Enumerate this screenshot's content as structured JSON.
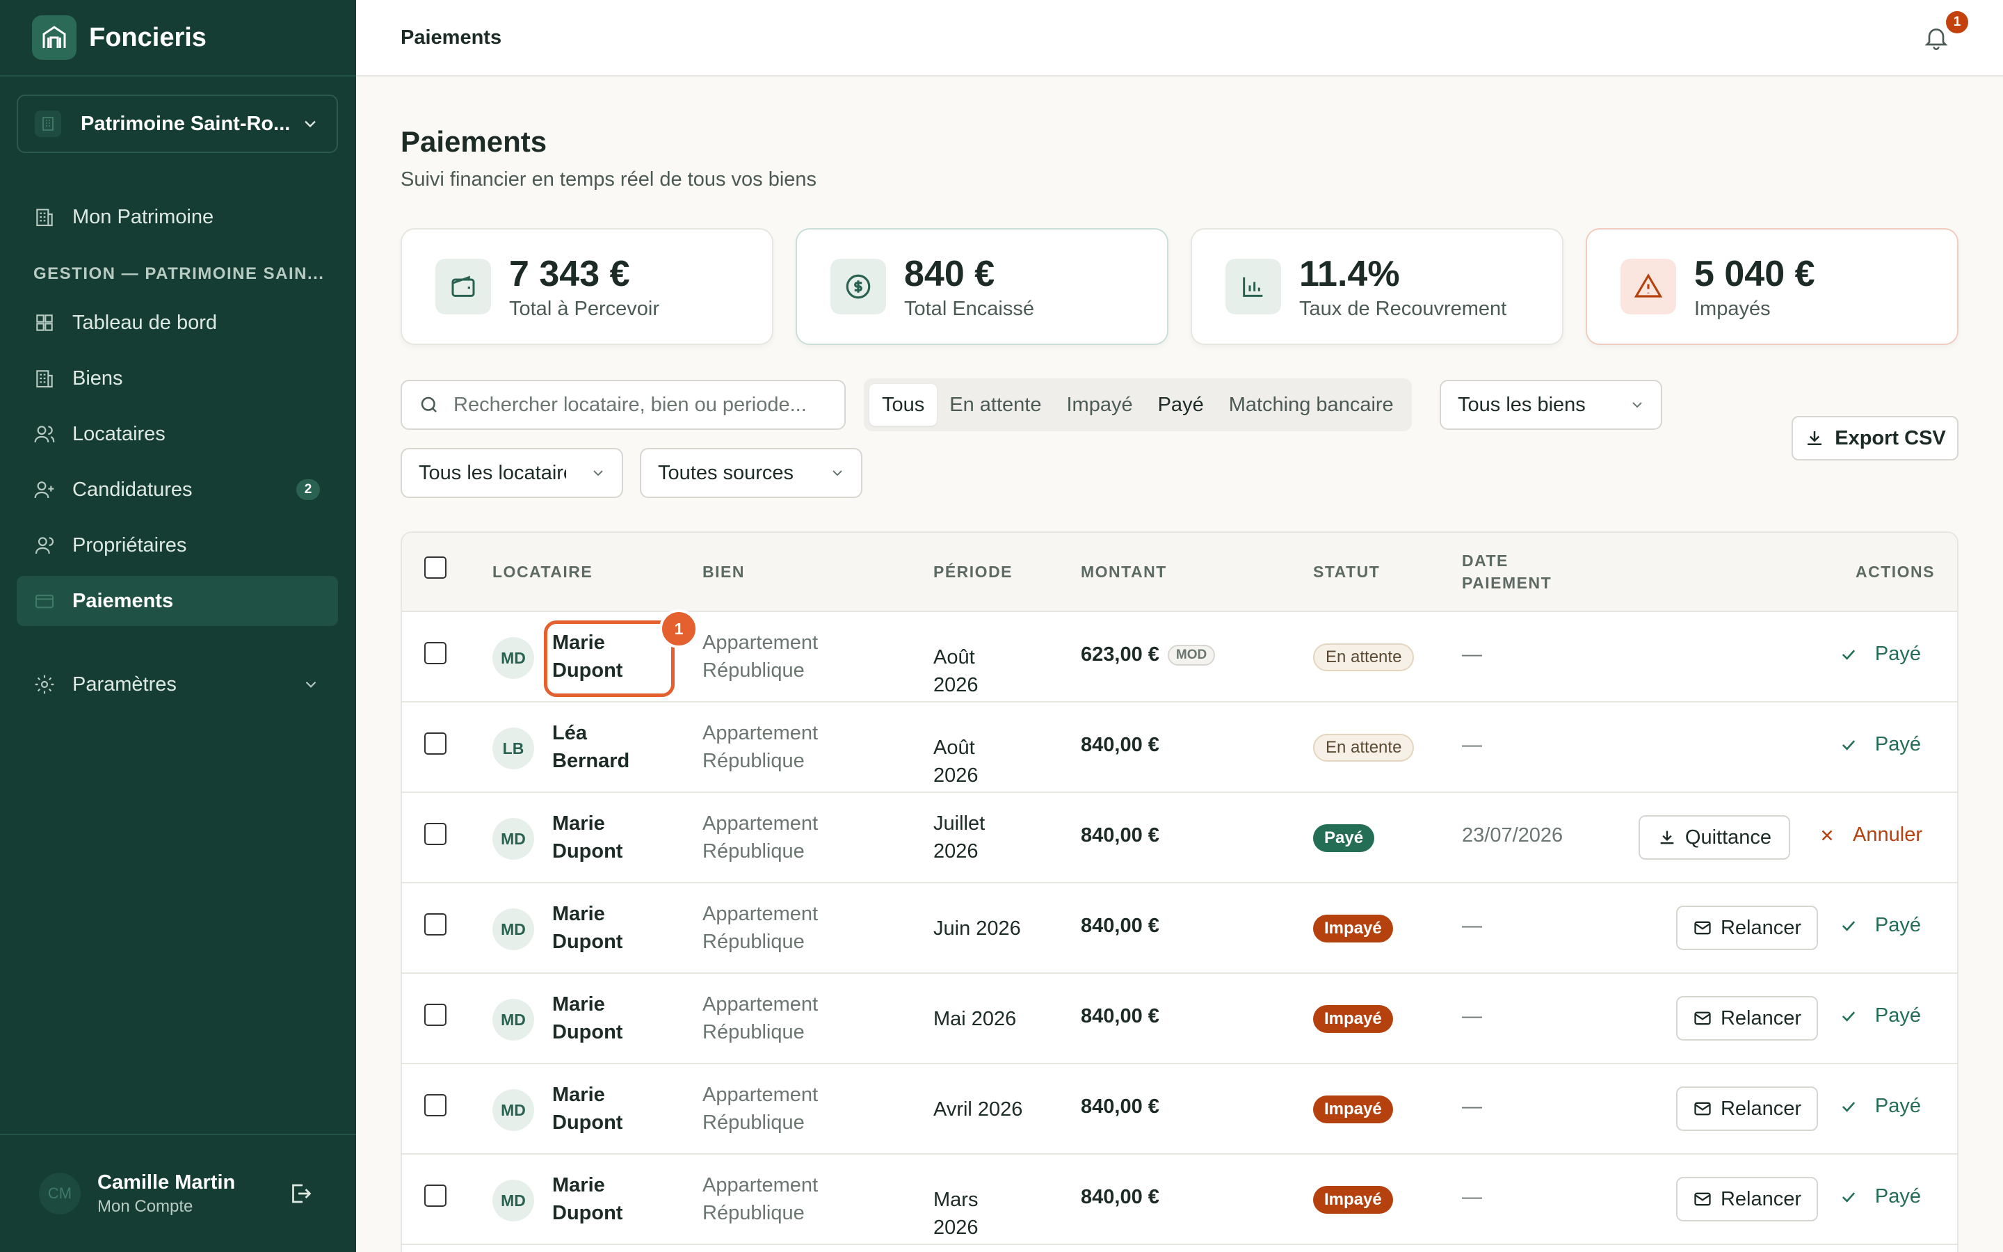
{
  "app": {
    "name": "Foncieris"
  },
  "workspace": {
    "name": "Patrimoine Saint-Ro..."
  },
  "sidebar": {
    "top_item": "Mon Patrimoine",
    "section_label": "GESTION — PATRIMOINE SAIN...",
    "items": [
      {
        "label": "Tableau de bord"
      },
      {
        "label": "Biens"
      },
      {
        "label": "Locataires"
      },
      {
        "label": "Candidatures",
        "badge": "2"
      },
      {
        "label": "Propriétaires"
      },
      {
        "label": "Paiements",
        "active": true
      }
    ],
    "settings": "Paramètres",
    "user": {
      "initials": "CM",
      "name": "Camille Martin",
      "subtitle": "Mon Compte"
    }
  },
  "header": {
    "title": "Paiements",
    "notification_count": "1"
  },
  "page": {
    "title": "Paiements",
    "subtitle": "Suivi financier en temps réel de tous vos biens"
  },
  "stats": [
    {
      "value": "7 343 €",
      "label": "Total à Percevoir",
      "icon": "wallet-icon"
    },
    {
      "value": "840 €",
      "label": "Total Encaissé",
      "icon": "dollar-circle-icon"
    },
    {
      "value": "11.4%",
      "label": "Taux de Recouvrement",
      "icon": "bar-chart-icon"
    },
    {
      "value": "5 040 €",
      "label": "Impayés",
      "icon": "alert-triangle-icon"
    }
  ],
  "filters": {
    "search_placeholder": "Rechercher locataire, bien ou periode...",
    "segments": [
      "Tous",
      "En attente",
      "Impayé",
      "Payé",
      "Matching bancaire"
    ],
    "active_segment": "Tous",
    "property_select": "Tous les biens",
    "tenant_select": "Tous les locataires",
    "source_select": "Toutes sources",
    "export_label": "Export CSV"
  },
  "table": {
    "headers": {
      "tenant": "LOCATAIRE",
      "property": "BIEN",
      "period": "PÉRIODE",
      "amount": "MONTANT",
      "status": "STATUT",
      "date_line1": "DATE",
      "date_line2": "PAIEMENT",
      "actions": "ACTIONS"
    },
    "rows": [
      {
        "initials": "MD",
        "first": "Marie",
        "last": "Dupont",
        "prop1": "Appartement",
        "prop2": "République",
        "period1": "Août 2026",
        "period2": "",
        "amount": "623,00 €",
        "tag": "MOD",
        "status": "En attente",
        "date": "—",
        "pay_label": "Payé"
      },
      {
        "initials": "LB",
        "first": "Léa",
        "last": "Bernard",
        "prop1": "Appartement",
        "prop2": "République",
        "period1": "Août 2026",
        "period2": "",
        "amount": "840,00 €",
        "status": "En attente",
        "date": "—",
        "pay_label": "Payé"
      },
      {
        "initials": "MD",
        "first": "Marie",
        "last": "Dupont",
        "prop1": "Appartement",
        "prop2": "République",
        "period1": "Juillet",
        "period2": "2026",
        "amount": "840,00 €",
        "status": "Payé",
        "date": "23/07/2026",
        "receipt_label": "Quittance",
        "cancel_label": "Annuler"
      },
      {
        "initials": "MD",
        "first": "Marie",
        "last": "Dupont",
        "prop1": "Appartement",
        "prop2": "République",
        "period1": "Juin 2026",
        "period2": "",
        "amount": "840,00 €",
        "status": "Impayé",
        "date": "—",
        "remind_label": "Relancer",
        "pay_label": "Payé"
      },
      {
        "initials": "MD",
        "first": "Marie",
        "last": "Dupont",
        "prop1": "Appartement",
        "prop2": "République",
        "period1": "Mai 2026",
        "period2": "",
        "amount": "840,00 €",
        "status": "Impayé",
        "date": "—",
        "remind_label": "Relancer",
        "pay_label": "Payé"
      },
      {
        "initials": "MD",
        "first": "Marie",
        "last": "Dupont",
        "prop1": "Appartement",
        "prop2": "République",
        "period1": "Avril 2026",
        "period2": "",
        "amount": "840,00 €",
        "status": "Impayé",
        "date": "—",
        "remind_label": "Relancer",
        "pay_label": "Payé"
      },
      {
        "initials": "MD",
        "first": "Marie",
        "last": "Dupont",
        "prop1": "Appartement",
        "prop2": "République",
        "period1": "Mars 2026",
        "period2": "",
        "amount": "840,00 €",
        "status": "Impayé",
        "date": "—",
        "remind_label": "Relancer",
        "pay_label": "Payé"
      }
    ]
  },
  "annotation": {
    "badge": "1"
  },
  "colors": {
    "sidebar": "#153d33",
    "accent": "#236e55",
    "danger": "#b5410f",
    "highlight": "#e4602e"
  }
}
